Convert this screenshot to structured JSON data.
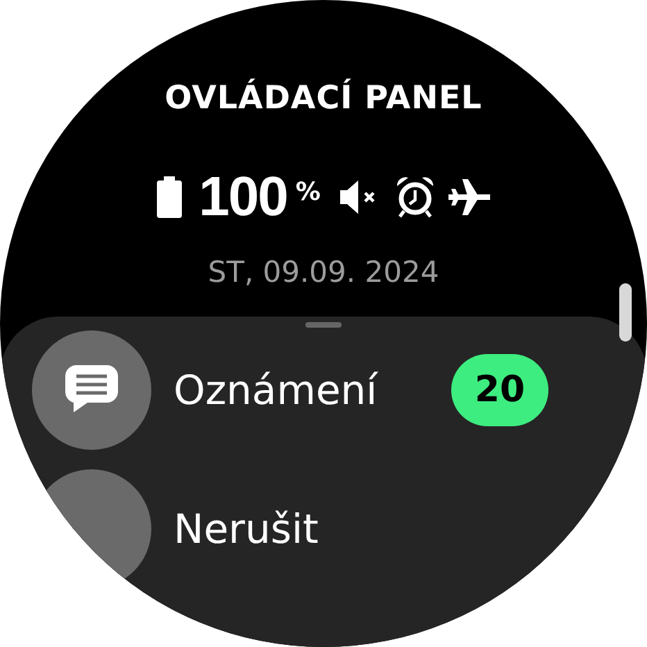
{
  "title": "OVLÁDACÍ PANEL",
  "status": {
    "battery_value": "100",
    "battery_unit": "%",
    "indicators": [
      {
        "kind": "mute"
      },
      {
        "kind": "alarm"
      },
      {
        "kind": "airplane"
      }
    ]
  },
  "date": "ST, 09.09. 2024",
  "items": [
    {
      "kind": "notifications",
      "label": "Oznámení",
      "badge": "20",
      "color": "#3ded7f"
    },
    {
      "kind": "dnd",
      "label": "Nerušit"
    }
  ]
}
